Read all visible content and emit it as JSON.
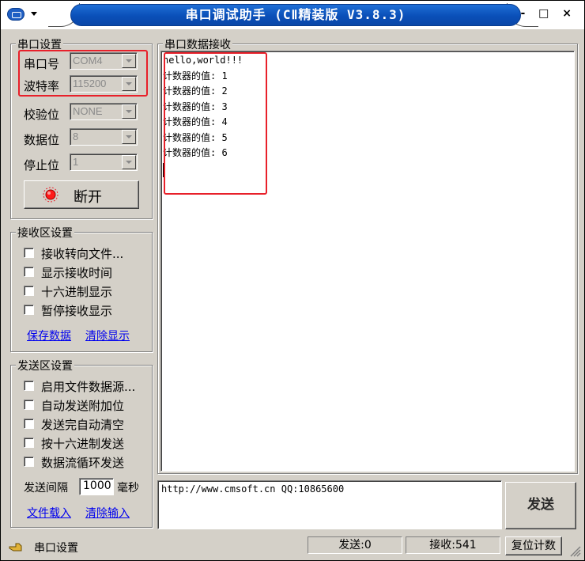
{
  "window": {
    "title": "串口调试助手 (CⅡ精装版 V3.8.3)",
    "minimize": "-",
    "maximize": "□",
    "close": "×"
  },
  "serial_settings": {
    "group_title": "串口设置",
    "port_label": "串口号",
    "port_value": "COM4",
    "baud_label": "波特率",
    "baud_value": "115200",
    "parity_label": "校验位",
    "parity_value": "NONE",
    "databits_label": "数据位",
    "databits_value": "8",
    "stopbits_label": "停止位",
    "stopbits_value": "1",
    "disconnect_label": "断开"
  },
  "receive_settings": {
    "group_title": "接收区设置",
    "options": [
      "接收转向文件...",
      "显示接收时间",
      "十六进制显示",
      "暂停接收显示"
    ],
    "save_link": "保存数据",
    "clear_link": "清除显示"
  },
  "send_settings": {
    "group_title": "发送区设置",
    "options": [
      "启用文件数据源...",
      "自动发送附加位",
      "发送完自动清空",
      "按十六进制发送",
      "数据流循环发送"
    ],
    "interval_label": "发送间隔",
    "interval_value": "1000",
    "interval_unit": "毫秒",
    "load_file_link": "文件载入",
    "clear_input_link": "清除输入"
  },
  "receive_area": {
    "group_title": "串口数据接收",
    "lines": [
      "hello,world!!!",
      "计数器的值: 1",
      "计数器的值: 2",
      "计数器的值: 3",
      "计数器的值: 4",
      "计数器的值: 5",
      "计数器的值: 6"
    ]
  },
  "send_area": {
    "text": "http://www.cmsoft.cn QQ:10865600",
    "send_button": "发送"
  },
  "statusbar": {
    "label": "串口设置",
    "sent": "发送:0",
    "received": "接收:541",
    "reset_button": "复位计数"
  },
  "colors": {
    "highlight_box": "#e8202a",
    "title_bar": "#0a4fb8",
    "link": "#0000ee"
  }
}
